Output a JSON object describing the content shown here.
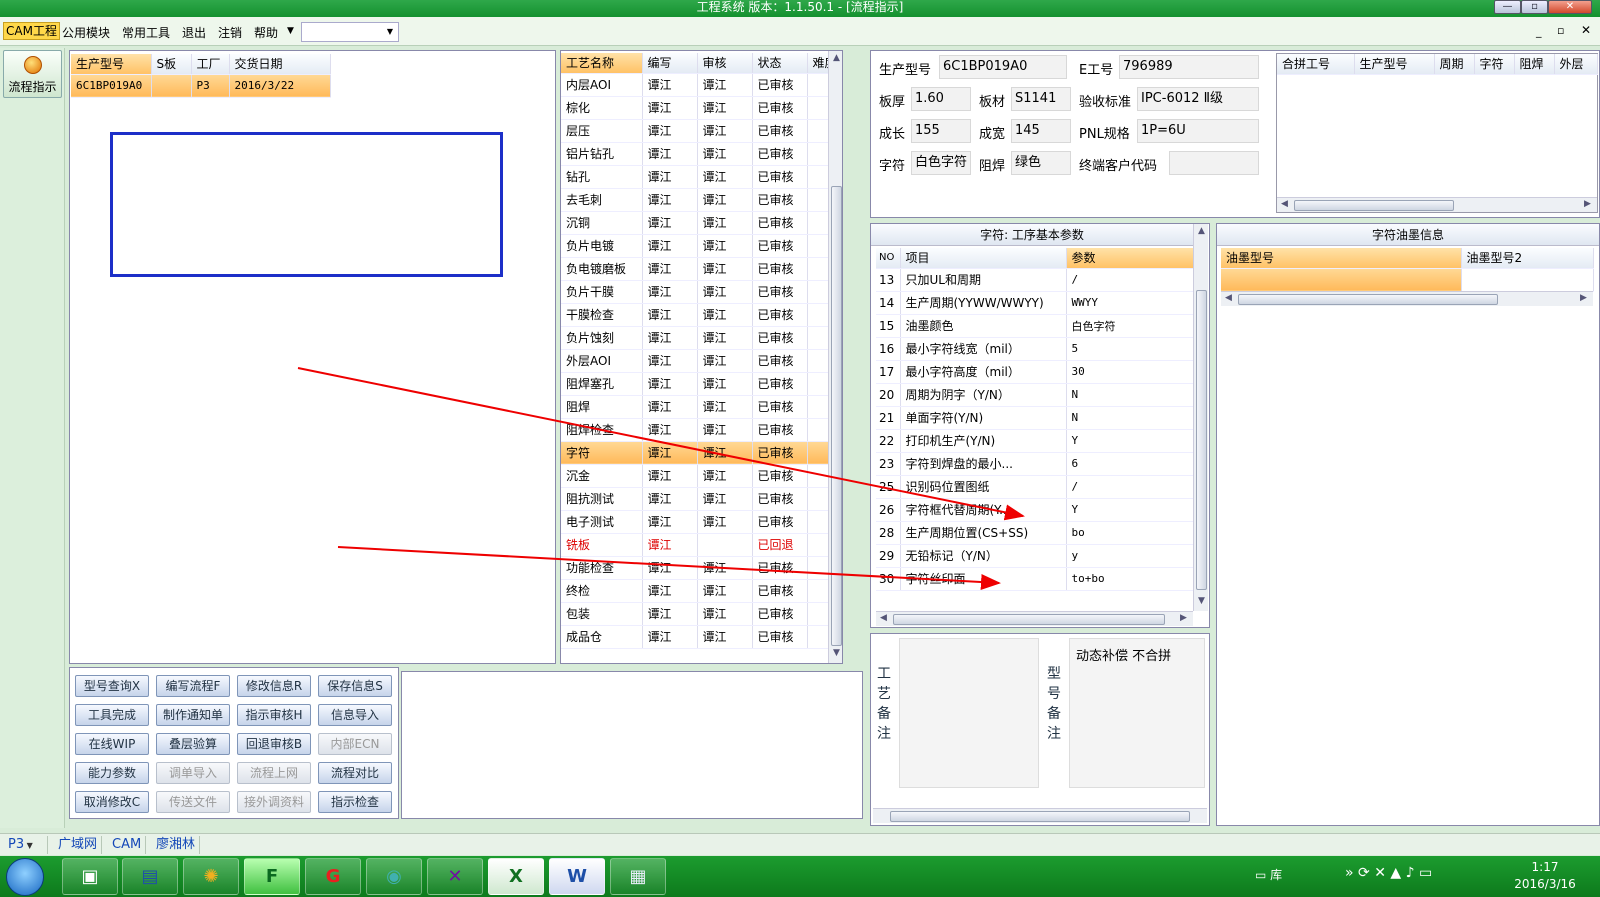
{
  "window": {
    "title": "工程系统   版本：1.1.50.1 - [流程指示]"
  },
  "menu": {
    "items": [
      "CAM工程",
      "公用模块",
      "常用工具",
      "退出",
      "注销",
      "帮助"
    ]
  },
  "side": {
    "flow_label": "流程指示"
  },
  "order": {
    "headers": [
      "生产型号",
      "S板",
      "工厂",
      "交货日期"
    ],
    "row": [
      "6C1BP019A0",
      "",
      "P3",
      "2016/3/22"
    ]
  },
  "process": {
    "headers": [
      "工艺名称",
      "编写",
      "审核",
      "状态",
      "难度"
    ],
    "rows": [
      [
        "内层AOI",
        "谭江",
        "谭江",
        "已审核",
        ""
      ],
      [
        "棕化",
        "谭江",
        "谭江",
        "已审核",
        ""
      ],
      [
        "层压",
        "谭江",
        "谭江",
        "已审核",
        ""
      ],
      [
        "铝片钻孔",
        "谭江",
        "谭江",
        "已审核",
        ""
      ],
      [
        "钻孔",
        "谭江",
        "谭江",
        "已审核",
        ""
      ],
      [
        "去毛刺",
        "谭江",
        "谭江",
        "已审核",
        ""
      ],
      [
        "沉铜",
        "谭江",
        "谭江",
        "已审核",
        ""
      ],
      [
        "负片电镀",
        "谭江",
        "谭江",
        "已审核",
        ""
      ],
      [
        "负电镀磨板",
        "谭江",
        "谭江",
        "已审核",
        ""
      ],
      [
        "负片干膜",
        "谭江",
        "谭江",
        "已审核",
        ""
      ],
      [
        "干膜检查",
        "谭江",
        "谭江",
        "已审核",
        ""
      ],
      [
        "负片蚀刻",
        "谭江",
        "谭江",
        "已审核",
        ""
      ],
      [
        "外层AOI",
        "谭江",
        "谭江",
        "已审核",
        ""
      ],
      [
        "阻焊塞孔",
        "谭江",
        "谭江",
        "已审核",
        ""
      ],
      [
        "阻焊",
        "谭江",
        "谭江",
        "已审核",
        ""
      ],
      [
        "阻焊检查",
        "谭江",
        "谭江",
        "已审核",
        ""
      ],
      [
        "字符",
        "谭江",
        "谭江",
        "已审核",
        ""
      ],
      [
        "沉金",
        "谭江",
        "谭江",
        "已审核",
        ""
      ],
      [
        "阻抗测试",
        "谭江",
        "谭江",
        "已审核",
        ""
      ],
      [
        "电子测试",
        "谭江",
        "谭江",
        "已审核",
        ""
      ],
      [
        "铣板",
        "谭江",
        "",
        "已回退",
        ""
      ],
      [
        "功能检查",
        "谭江",
        "谭江",
        "已审核",
        ""
      ],
      [
        "终检",
        "谭江",
        "谭江",
        "已审核",
        ""
      ],
      [
        "包装",
        "谭江",
        "谭江",
        "已审核",
        ""
      ],
      [
        "成品仓",
        "谭江",
        "谭江",
        "已审核",
        ""
      ]
    ],
    "selected": 16,
    "returned": 20
  },
  "buttons": [
    [
      "型号查询X",
      "编写流程F",
      "修改信息R",
      "保存信息S"
    ],
    [
      "工具完成",
      "制作通知单",
      "指示审核H",
      "信息导入"
    ],
    [
      "在线WIP",
      "叠层验算",
      "回退审核B",
      "内部ECN"
    ],
    [
      "能力参数",
      "调单导入",
      "流程上网",
      "流程对比"
    ],
    [
      "取消修改C",
      "传送文件",
      "接外调资料",
      "指示检查"
    ]
  ],
  "info": {
    "model_label": "生产型号",
    "model": "6C1BP019A0",
    "e_label": "E工号",
    "e": "796989",
    "thick_label": "板厚",
    "thick": "1.60",
    "mat_label": "板材",
    "mat": "S1141",
    "std_label": "验收标准",
    "std": "IPC-6012 Ⅱ级",
    "len_label": "成长",
    "len": "155",
    "wid_label": "成宽",
    "wid": "145",
    "pnl_label": "PNL规格",
    "pnl": "1P=6U",
    "char_label": "字符",
    "char": "白色字符",
    "mask_label": "阻焊",
    "mask": "绿色",
    "cust_label": "终端客户代码",
    "cust": ""
  },
  "merge": {
    "headers": [
      "合拼工号",
      "生产型号",
      "周期",
      "字符",
      "阻焊",
      "外层"
    ]
  },
  "params": {
    "title": "字符: 工序基本参数",
    "headers": [
      "NO",
      "项目",
      "参数"
    ],
    "rows": [
      [
        "13",
        "只加UL和周期",
        "/"
      ],
      [
        "14",
        "生产周期(YYWW/WWYY)",
        "WWYY"
      ],
      [
        "15",
        "油墨颜色",
        "白色字符"
      ],
      [
        "16",
        "最小字符线宽（mil）",
        "5"
      ],
      [
        "17",
        "最小字符高度（mil）",
        "30"
      ],
      [
        "20",
        "周期为阴字（Y/N）",
        "N"
      ],
      [
        "21",
        "单面字符(Y/N)",
        "N"
      ],
      [
        "22",
        "打印机生产(Y/N)",
        "Y"
      ],
      [
        "23",
        "字符到焊盘的最小...",
        "6"
      ],
      [
        "25",
        "识别码位置图纸",
        "/"
      ],
      [
        "26",
        "字符框代替周期(Y...",
        "Y"
      ],
      [
        "28",
        "生产周期位置(CS+SS)",
        "bo"
      ],
      [
        "29",
        "无铅标记（Y/N）",
        "y"
      ],
      [
        "30",
        "字符丝印面",
        "to+bo"
      ]
    ]
  },
  "ink": {
    "title": "字符油墨信息",
    "headers": [
      "油墨型号",
      "油墨型号2"
    ]
  },
  "remarks": {
    "process_label": "工艺备注",
    "model_label": "型号备注",
    "model_text": "动态补偿 不合拼"
  },
  "status": {
    "factory": "P3",
    "items": [
      "广域网",
      "CAM",
      "廖湘林"
    ]
  },
  "taskbar": {
    "tray_label": "库",
    "time": "1:17",
    "date": "2016/3/16"
  }
}
